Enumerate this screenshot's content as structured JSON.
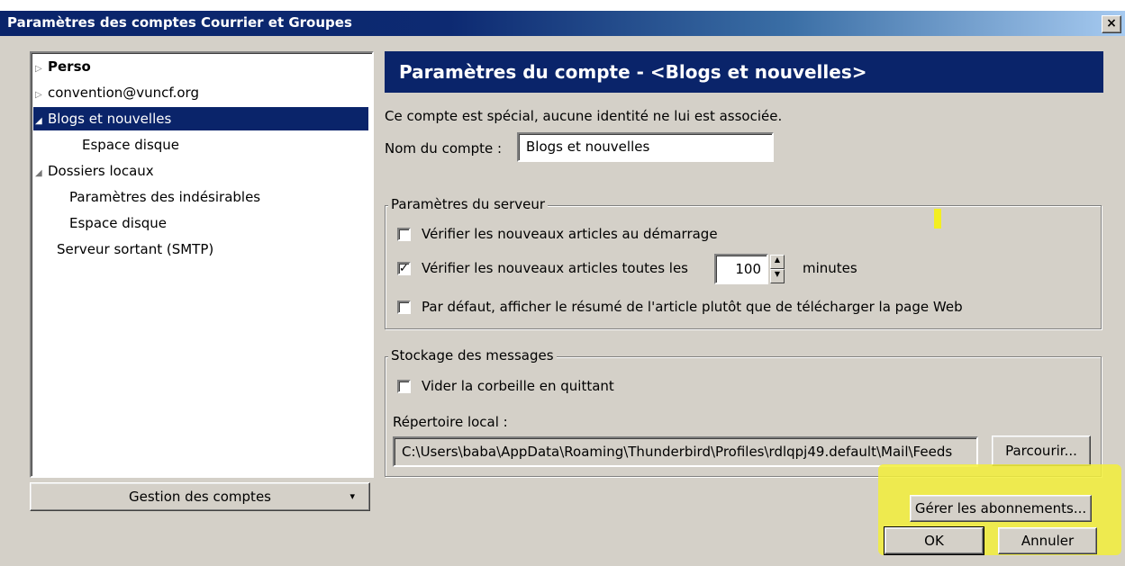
{
  "window": {
    "title": "Paramètres des comptes Courrier et Groupes",
    "close_glyph": "×"
  },
  "tree": {
    "items": [
      {
        "twisty": "▷",
        "label": "Perso"
      },
      {
        "twisty": "▷",
        "label": "convention@vuncf.org"
      },
      {
        "twisty": "◢",
        "label": "Blogs et nouvelles"
      },
      {
        "twisty": "",
        "label": "Espace disque"
      },
      {
        "twisty": "◢",
        "label": "Dossiers locaux"
      },
      {
        "twisty": "",
        "label": "Paramètres des indésirables"
      },
      {
        "twisty": "",
        "label": "Espace disque"
      },
      {
        "twisty": "",
        "label": "Serveur sortant (SMTP)"
      }
    ]
  },
  "account_actions": {
    "label": "Gestion des comptes",
    "arrow": "▾"
  },
  "header": {
    "title": "Paramètres du compte - <Blogs et nouvelles>"
  },
  "notice": "Ce compte est spécial, aucune identité ne lui est associée.",
  "account_name": {
    "label": "Nom du compte :",
    "value": "Blogs et nouvelles"
  },
  "server_settings": {
    "legend": "Paramètres du serveur",
    "check_startup": {
      "label": "Vérifier les nouveaux articles au démarrage",
      "checked": false
    },
    "check_every": {
      "label": "Vérifier les nouveaux articles toutes les",
      "checked": true,
      "value": "100",
      "unit": "minutes"
    },
    "show_summary": {
      "label": "Par défaut, afficher le résumé de l'article plutôt que de télécharger la page Web",
      "checked": false
    }
  },
  "storage": {
    "legend": "Stockage des messages",
    "empty_trash": {
      "label": "Vider la corbeille en quittant",
      "checked": false
    },
    "local_dir_label": "Répertoire local :",
    "local_dir_value": "C:\\Users\\baba\\AppData\\Roaming\\Thunderbird\\Profiles\\rdlqpj49.default\\Mail\\Feeds",
    "browse_label": "Parcourir..."
  },
  "manage_subscriptions_label": "Gérer les abonnements...",
  "ok_label": "OK",
  "cancel_label": "Annuler",
  "colors": {
    "selection": "#0a246a",
    "dialog_bg": "#d4d0c8",
    "highlighter": "#f2ee3a"
  }
}
